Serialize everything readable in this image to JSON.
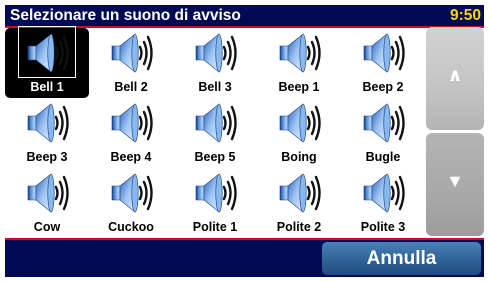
{
  "header": {
    "title": "Selezionare un suono di avviso",
    "clock": "9:50"
  },
  "sounds": [
    {
      "label": "Bell 1",
      "selected": true
    },
    {
      "label": "Bell 2"
    },
    {
      "label": "Bell 3"
    },
    {
      "label": "Beep 1"
    },
    {
      "label": "Beep 2"
    },
    {
      "label": "Beep 3"
    },
    {
      "label": "Beep 4"
    },
    {
      "label": "Beep 5"
    },
    {
      "label": "Boing"
    },
    {
      "label": "Bugle"
    },
    {
      "label": "Cow"
    },
    {
      "label": "Cuckoo"
    },
    {
      "label": "Polite 1"
    },
    {
      "label": "Polite 2"
    },
    {
      "label": "Polite 3"
    }
  ],
  "sound_icon": "speaker-icon",
  "scroll": {
    "up_label": "∧",
    "down_label": "▼"
  },
  "footer": {
    "cancel_label": "Annulla"
  },
  "colors": {
    "bar": "#000a55",
    "accent_line": "#c4102a",
    "clock": "#ffd400",
    "button": "#2f6196"
  }
}
